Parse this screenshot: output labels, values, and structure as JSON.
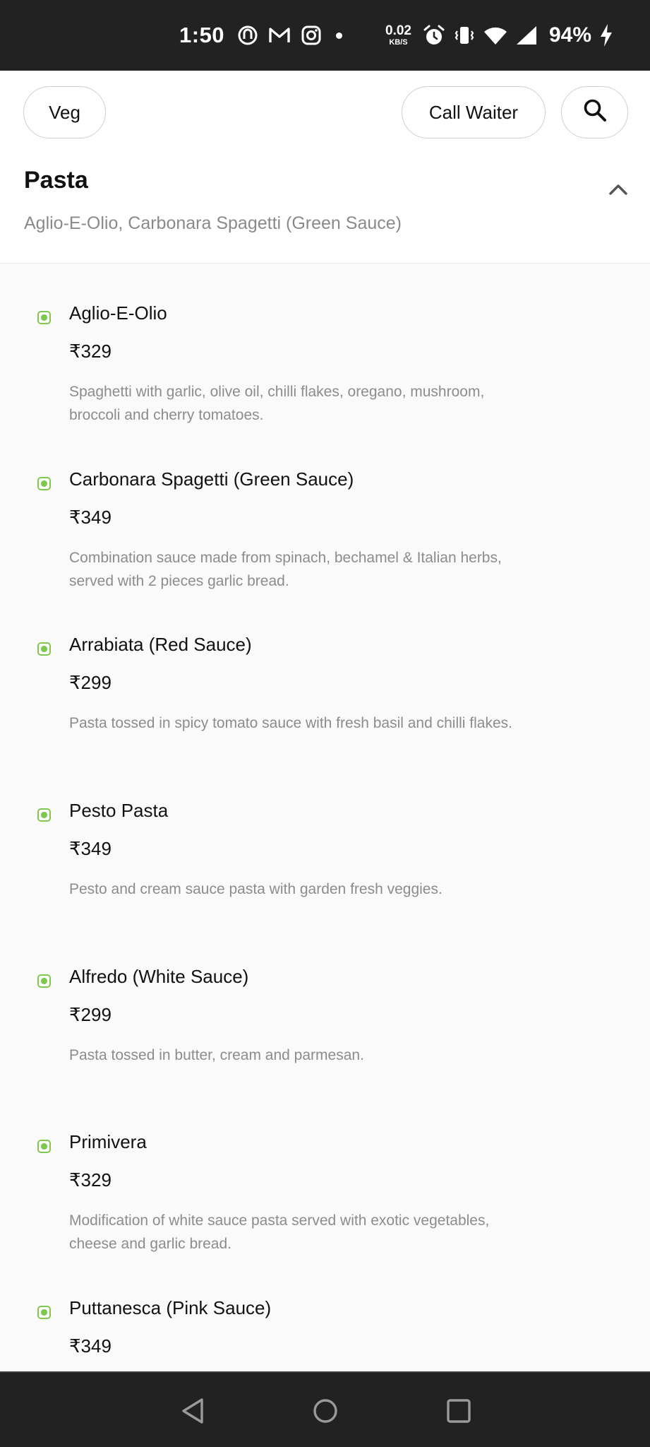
{
  "status_bar": {
    "time": "1:50",
    "notification_icons": [
      "sync-app-icon",
      "gmail-icon",
      "instagram-icon"
    ],
    "network_speed_value": "0.02",
    "network_speed_unit": "KB/S",
    "right_icons": [
      "alarm-icon",
      "vibrate-icon",
      "wifi-icon",
      "signal-icon"
    ],
    "battery_percent": "94%"
  },
  "toolbar": {
    "veg_label": "Veg",
    "call_waiter_label": "Call Waiter",
    "search_icon": "search-icon"
  },
  "category": {
    "title": "Pasta",
    "subtitle": "Aglio-E-Olio, Carbonara Spagetti (Green Sauce)",
    "collapse_icon": "chevron-up-icon"
  },
  "items": [
    {
      "name": "Aglio-E-Olio",
      "price": "₹329",
      "description": "Spaghetti with garlic, olive oil, chilli flakes, oregano, mushroom, broccoli and cherry tomatoes."
    },
    {
      "name": "Carbonara Spagetti (Green Sauce)",
      "price": "₹349",
      "description": "Combination sauce made from spinach, bechamel & Italian herbs, served with 2 pieces garlic bread."
    },
    {
      "name": "Arrabiata (Red Sauce)",
      "price": "₹299",
      "description": "Pasta tossed in spicy tomato sauce with fresh basil and chilli flakes."
    },
    {
      "name": "Pesto Pasta",
      "price": "₹349",
      "description": "Pesto and cream sauce pasta with garden fresh veggies."
    },
    {
      "name": "Alfredo (White Sauce)",
      "price": "₹299",
      "description": "Pasta tossed in butter, cream and parmesan."
    },
    {
      "name": "Primivera",
      "price": "₹329",
      "description": "Modification of white sauce pasta served with exotic vegetables, cheese and garlic bread."
    },
    {
      "name": "Puttanesca (Pink Sauce)",
      "price": "₹349",
      "description": ""
    }
  ],
  "colors": {
    "veg_indicator": "#7dc94b",
    "system_bar": "#222222",
    "muted_text": "#8c8c8c"
  },
  "nav_bar": {
    "buttons": [
      "back-icon",
      "home-icon",
      "recents-icon"
    ]
  }
}
